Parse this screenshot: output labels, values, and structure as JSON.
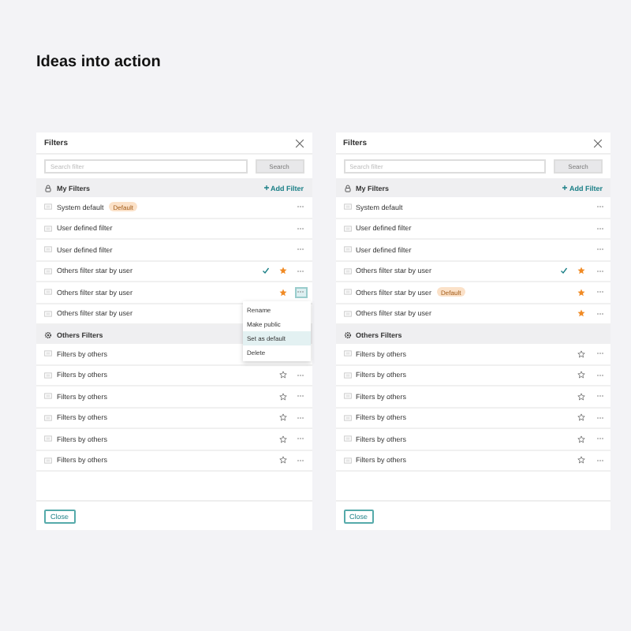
{
  "heading": "Ideas into action",
  "panels": [
    {
      "title": "Filters",
      "search": {
        "placeholder": "Search filter",
        "button": "Search"
      },
      "sections": [
        {
          "kind": "mine",
          "title": "My Filters",
          "action": "Add Filter",
          "rows": [
            {
              "label": "System default",
              "badge": "Default",
              "checked": false,
              "star_shown": false,
              "more": true,
              "menu_open": false
            },
            {
              "label": "User defined filter",
              "checked": false,
              "star_shown": false,
              "more": true,
              "menu_open": false
            },
            {
              "label": "User defined filter",
              "checked": false,
              "star_shown": false,
              "more": true,
              "menu_open": false
            },
            {
              "label": "Others filter star by user",
              "checked": true,
              "star_shown": true,
              "starred": true,
              "more": true,
              "menu_open": false
            },
            {
              "label": "Others filter star by user",
              "checked": false,
              "star_shown": true,
              "starred": true,
              "more": true,
              "menu_open": true
            },
            {
              "label": "Others filter star by user",
              "checked": false,
              "star_shown": false,
              "more": false,
              "menu_open": false
            }
          ]
        },
        {
          "kind": "others",
          "title": "Others Filters",
          "rows": [
            {
              "label": "Filters by others",
              "checked": false,
              "star_shown": false,
              "more": false,
              "menu_open": false
            },
            {
              "label": "Filters by others",
              "checked": false,
              "star_shown": true,
              "starred": false,
              "more": true,
              "menu_open": false
            },
            {
              "label": "Filters by others",
              "checked": false,
              "star_shown": true,
              "starred": false,
              "more": true,
              "menu_open": false
            },
            {
              "label": "Filters by others",
              "checked": false,
              "star_shown": true,
              "starred": false,
              "more": true,
              "menu_open": false
            },
            {
              "label": "Filters by others",
              "checked": false,
              "star_shown": true,
              "starred": false,
              "more": true,
              "menu_open": false
            },
            {
              "label": "Filters by others",
              "checked": false,
              "star_shown": true,
              "starred": false,
              "more": true,
              "menu_open": false
            }
          ]
        }
      ],
      "menu": [
        {
          "label": "Rename",
          "selected": false
        },
        {
          "label": "Make public",
          "selected": false
        },
        {
          "label": "Set as default",
          "selected": true
        },
        {
          "label": "Delete",
          "selected": false
        }
      ],
      "close_button": "Close"
    },
    {
      "title": "Filters",
      "search": {
        "placeholder": "Search filter",
        "button": "Search"
      },
      "sections": [
        {
          "kind": "mine",
          "title": "My Filters",
          "action": "Add Filter",
          "rows": [
            {
              "label": "System default",
              "checked": false,
              "star_shown": false,
              "more": true,
              "menu_open": false
            },
            {
              "label": "User defined filter",
              "checked": false,
              "star_shown": false,
              "more": true,
              "menu_open": false
            },
            {
              "label": "User defined filter",
              "checked": false,
              "star_shown": false,
              "more": true,
              "menu_open": false
            },
            {
              "label": "Others filter star by user",
              "checked": true,
              "star_shown": true,
              "starred": true,
              "more": true,
              "menu_open": false
            },
            {
              "label": "Others filter star by user",
              "badge": "Default",
              "checked": false,
              "star_shown": true,
              "starred": true,
              "more": true,
              "menu_open": false
            },
            {
              "label": "Others filter star by user",
              "checked": false,
              "star_shown": true,
              "starred": true,
              "more": true,
              "menu_open": false
            }
          ]
        },
        {
          "kind": "others",
          "title": "Others Filters",
          "rows": [
            {
              "label": "Filters by others",
              "checked": false,
              "star_shown": true,
              "starred": false,
              "more": true,
              "menu_open": false
            },
            {
              "label": "Filters by others",
              "checked": false,
              "star_shown": true,
              "starred": false,
              "more": true,
              "menu_open": false
            },
            {
              "label": "Filters by others",
              "checked": false,
              "star_shown": true,
              "starred": false,
              "more": true,
              "menu_open": false
            },
            {
              "label": "Filters by others",
              "checked": false,
              "star_shown": true,
              "starred": false,
              "more": true,
              "menu_open": false
            },
            {
              "label": "Filters by others",
              "checked": false,
              "star_shown": true,
              "starred": false,
              "more": true,
              "menu_open": false
            },
            {
              "label": "Filters by others",
              "checked": false,
              "star_shown": true,
              "starred": false,
              "more": true,
              "menu_open": false
            }
          ]
        }
      ],
      "close_button": "Close"
    }
  ]
}
